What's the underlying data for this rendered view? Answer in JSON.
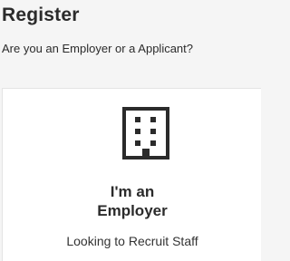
{
  "header": {
    "title": "Register",
    "subtitle": "Are you an Employer or a Applicant?"
  },
  "employer_card": {
    "icon": "building-icon",
    "heading_line1": "I'm an",
    "heading_line2": "Employer",
    "description": "Looking to Recruit Staff"
  },
  "colors": {
    "background": "#f5f5f5",
    "card": "#ffffff",
    "text": "#2b2b2b",
    "icon": "#2b2b2b"
  }
}
